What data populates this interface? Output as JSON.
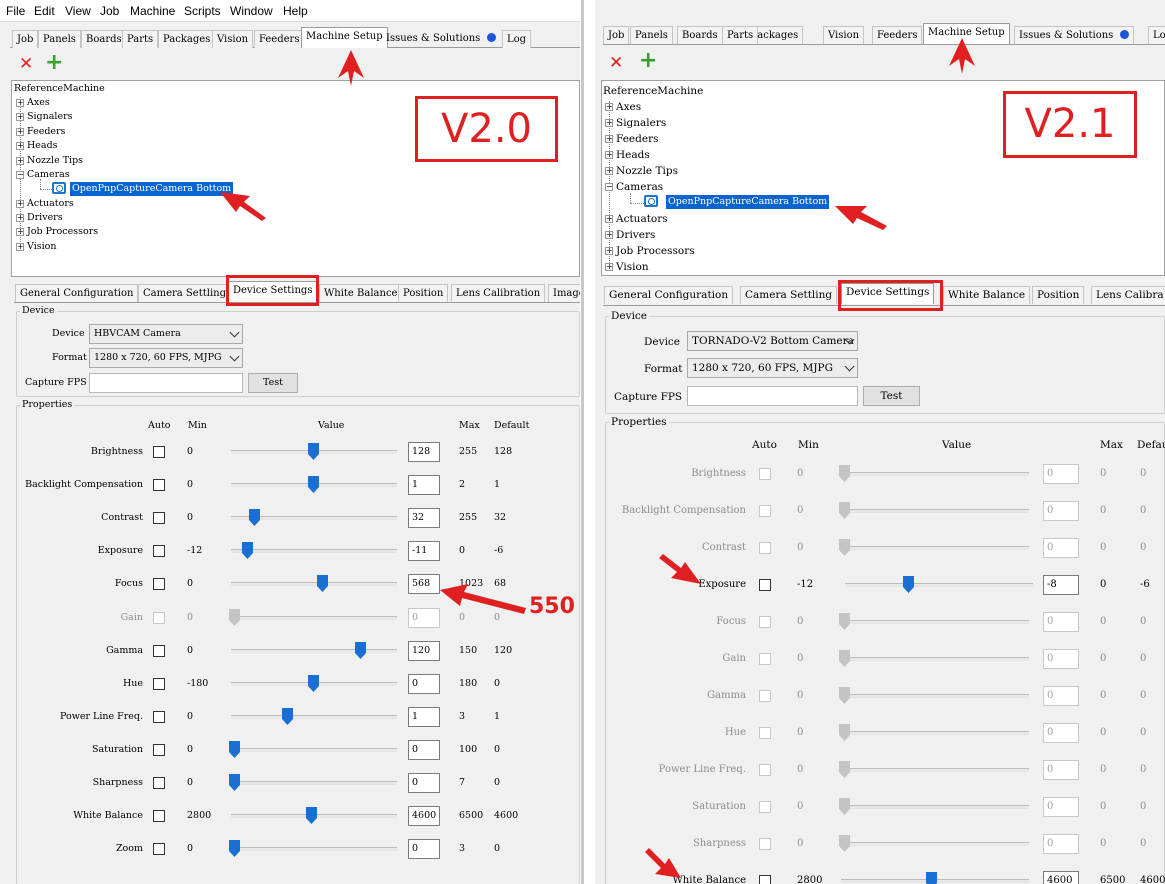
{
  "menu": [
    "File",
    "Edit",
    "View",
    "Job",
    "Machine",
    "Scripts",
    "Window",
    "Help"
  ],
  "colors": {
    "accent": "#0a64cf",
    "annotation": "#e02020",
    "add": "#3aa02c",
    "remove": "#e02020"
  },
  "toolbar": {
    "remove_icon": "✕",
    "add_icon": "+"
  },
  "tree_root": "ReferenceMachine",
  "tree_items": [
    "Axes",
    "Signalers",
    "Feeders",
    "Heads",
    "Nozzle Tips",
    "Cameras"
  ],
  "tree_items_after": [
    "Actuators",
    "Drivers",
    "Job Processors",
    "Vision"
  ],
  "tree_camera": "OpenPnpCaptureCamera Bottom",
  "device_group": "Device",
  "properties_group": "Properties",
  "labels": {
    "device": "Device",
    "format": "Format",
    "capture_fps": "Capture FPS",
    "test": "Test"
  },
  "headers": {
    "auto": "Auto",
    "min": "Min",
    "value": "Value",
    "max": "Max",
    "default": "Default"
  },
  "left": {
    "version": "V2.0",
    "top_tabs": [
      "Job",
      "Panels",
      "Boards",
      "Parts",
      "Packages",
      "Vision",
      "Feeders",
      "Machine Setup",
      "Issues & Solutions",
      "Log"
    ],
    "sub_tabs": [
      "General Configuration",
      "Camera Settling",
      "Device Settings",
      "White Balance",
      "Position",
      "Lens Calibration",
      "Image"
    ],
    "device_value": "HBVCAM Camera",
    "format_value": "1280 x 720, 60 FPS, MJPG",
    "annotation": "550",
    "properties": [
      {
        "label": "Brightness",
        "min": "0",
        "value": "128",
        "max": "255",
        "def": "128",
        "enabled": true,
        "level": 0.5
      },
      {
        "label": "Backlight Compensation",
        "min": "0",
        "value": "1",
        "max": "2",
        "def": "1",
        "enabled": true,
        "level": 0.5
      },
      {
        "label": "Contrast",
        "min": "0",
        "value": "32",
        "max": "255",
        "def": "32",
        "enabled": true,
        "level": 0.125
      },
      {
        "label": "Exposure",
        "min": "-12",
        "value": "-11",
        "max": "0",
        "def": "-6",
        "enabled": true,
        "level": 0.083
      },
      {
        "label": "Focus",
        "min": "0",
        "value": "568",
        "max": "1023",
        "def": "68",
        "enabled": true,
        "level": 0.555
      },
      {
        "label": "Gain",
        "min": "0",
        "value": "0",
        "max": "0",
        "def": "0",
        "enabled": false,
        "level": 0
      },
      {
        "label": "Gamma",
        "min": "0",
        "value": "120",
        "max": "150",
        "def": "120",
        "enabled": true,
        "level": 0.8
      },
      {
        "label": "Hue",
        "min": "-180",
        "value": "0",
        "max": "180",
        "def": "0",
        "enabled": true,
        "level": 0.5
      },
      {
        "label": "Power Line Freq.",
        "min": "0",
        "value": "1",
        "max": "3",
        "def": "1",
        "enabled": true,
        "level": 0.333
      },
      {
        "label": "Saturation",
        "min": "0",
        "value": "0",
        "max": "100",
        "def": "0",
        "enabled": true,
        "level": 0
      },
      {
        "label": "Sharpness",
        "min": "0",
        "value": "0",
        "max": "7",
        "def": "0",
        "enabled": true,
        "level": 0
      },
      {
        "label": "White Balance",
        "min": "2800",
        "value": "4600",
        "max": "6500",
        "def": "4600",
        "enabled": true,
        "level": 0.486
      },
      {
        "label": "Zoom",
        "min": "0",
        "value": "0",
        "max": "3",
        "def": "0",
        "enabled": true,
        "level": 0
      }
    ]
  },
  "right": {
    "version": "V2.1",
    "top_tabs": [
      "Job",
      "Panels",
      "Boards",
      "Packages",
      "Vision",
      "Feeders",
      "Machine Setup",
      "Issues & Solutions",
      "Lo"
    ],
    "sub_tabs": [
      "General Configuration",
      "Camera Settling",
      "Device Settings",
      "White Balance",
      "Position",
      "Lens Calibra"
    ],
    "device_value": "TORNADO-V2 Bottom Camera",
    "format_value": "1280 x 720, 60 FPS, MJPG",
    "properties": [
      {
        "label": "Brightness",
        "min": "0",
        "value": "0",
        "max": "0",
        "def": "0",
        "enabled": false,
        "level": 0
      },
      {
        "label": "Backlight Compensation",
        "min": "0",
        "value": "0",
        "max": "0",
        "def": "0",
        "enabled": false,
        "level": 0
      },
      {
        "label": "Contrast",
        "min": "0",
        "value": "0",
        "max": "0",
        "def": "0",
        "enabled": false,
        "level": 0
      },
      {
        "label": "Exposure",
        "min": "-12",
        "value": "-8",
        "max": "0",
        "def": "-6",
        "enabled": true,
        "level": 0.333
      },
      {
        "label": "Focus",
        "min": "0",
        "value": "0",
        "max": "0",
        "def": "0",
        "enabled": false,
        "level": 0
      },
      {
        "label": "Gain",
        "min": "0",
        "value": "0",
        "max": "0",
        "def": "0",
        "enabled": false,
        "level": 0
      },
      {
        "label": "Gamma",
        "min": "0",
        "value": "0",
        "max": "0",
        "def": "0",
        "enabled": false,
        "level": 0
      },
      {
        "label": "Hue",
        "min": "0",
        "value": "0",
        "max": "0",
        "def": "0",
        "enabled": false,
        "level": 0
      },
      {
        "label": "Power Line Freq.",
        "min": "0",
        "value": "0",
        "max": "0",
        "def": "0",
        "enabled": false,
        "level": 0
      },
      {
        "label": "Saturation",
        "min": "0",
        "value": "0",
        "max": "0",
        "def": "0",
        "enabled": false,
        "level": 0
      },
      {
        "label": "Sharpness",
        "min": "0",
        "value": "0",
        "max": "0",
        "def": "0",
        "enabled": false,
        "level": 0
      },
      {
        "label": "White Balance",
        "min": "2800",
        "value": "4600",
        "max": "6500",
        "def": "4600",
        "enabled": true,
        "level": 0.486
      }
    ]
  }
}
